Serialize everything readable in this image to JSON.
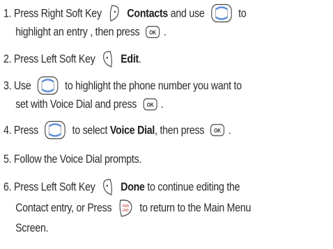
{
  "steps": [
    {
      "num": "1.",
      "t1": "Press Right Soft Key",
      "b1": "Contacts",
      "t2": "and use",
      "t3": "to",
      "t4": "highlight an entry , then press",
      "t5": "."
    },
    {
      "num": "2.",
      "t1": "Press Left Soft Key",
      "b1": "Edit",
      "t2": "."
    },
    {
      "num": "3.",
      "t1": "Use",
      "t2": "to highlight the phone number you want to",
      "t3": "set with Voice Dial and press",
      "t4": "."
    },
    {
      "num": "4.",
      "t1": "Press",
      "t2": "to select",
      "b1": "Voice Dial",
      "t3": ", then press",
      "t4": "."
    },
    {
      "num": "5.",
      "t1": "Follow the Voice Dial prompts."
    },
    {
      "num": "6.",
      "t1": "Press Left Soft Key",
      "b1": "Done",
      "t2": "to continue editing the",
      "t3": "Contact entry, or Press",
      "t4": "to return to the Main Menu",
      "t5": "Screen."
    }
  ],
  "icons": {
    "ok_label": "OK",
    "end_label": "END",
    "pwr_label": "PWR"
  }
}
